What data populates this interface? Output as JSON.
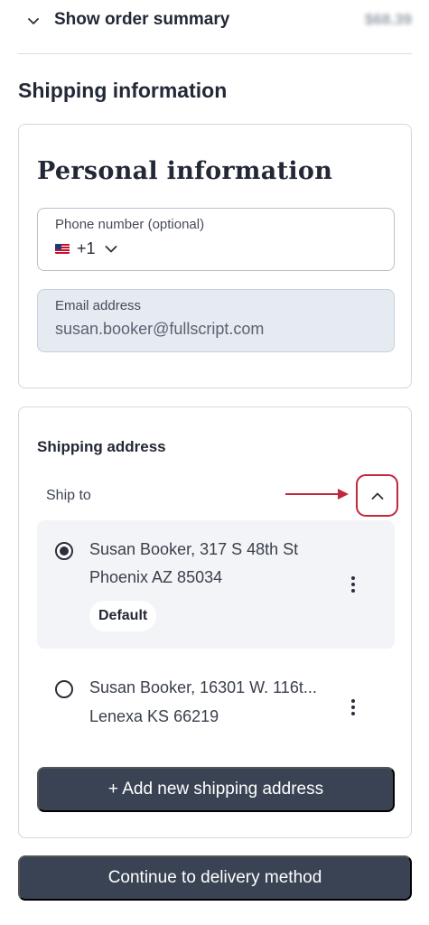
{
  "order_summary": {
    "label": "Show order summary",
    "amount": "$68.39",
    "icon": "chevron-down-icon"
  },
  "section_title": "Shipping information",
  "personal": {
    "heading": "Personal information",
    "phone": {
      "label": "Phone number (optional)",
      "country_code": "+1",
      "flag_icon": "us-flag-icon"
    },
    "email": {
      "label": "Email address",
      "value": "susan.booker@fullscript.com"
    }
  },
  "shipping": {
    "heading": "Shipping address",
    "ship_to_label": "Ship to",
    "addresses": [
      {
        "line1": "Susan Booker, 317 S 48th St",
        "line2": "Phoenix AZ 85034",
        "badge": "Default",
        "selected": true
      },
      {
        "line1": "Susan Booker, 16301 W. 116t...",
        "line2": "Lenexa KS 66219",
        "selected": false
      }
    ],
    "add_button_label": "+ Add new shipping address"
  },
  "continue_button_label": "Continue to delivery method",
  "colors": {
    "primary_button": "#394353",
    "annotation_red": "#c0283e",
    "email_field_bg": "#e6ebf2",
    "selected_option_bg": "#f3f4f7"
  }
}
